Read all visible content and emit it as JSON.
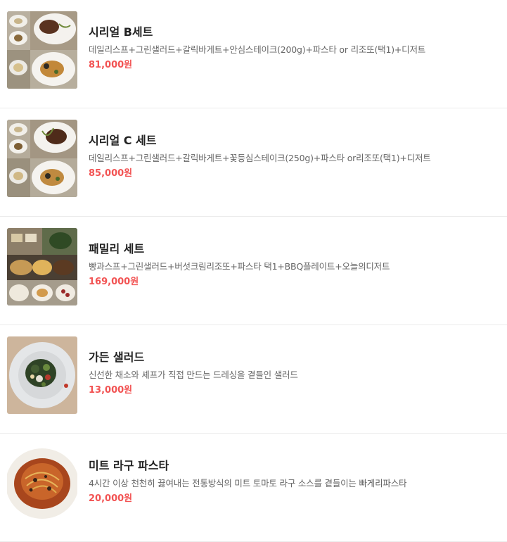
{
  "accent_price_color": "#f25353",
  "menu": [
    {
      "name": "시리얼 B세트",
      "description": "데일리스프+그린샐러드+갈릭바게트+안심스테이크(200g)+파스타 or 리조또(택1)+디저트",
      "price": "81,000원",
      "image": "set-course-photo-icon"
    },
    {
      "name": "시리얼 C 세트",
      "description": "데일리스프+그린샐러드+갈릭바게트+꽃등심스테이크(250g)+파스타 or리조또(택1)+디저트",
      "price": "85,000원",
      "image": "set-course-photo-icon"
    },
    {
      "name": "패밀리 세트",
      "description": "빵과스프+그린샐러드+버섯크림리조또+파스타 택1+BBQ플레이트+오늘의디저트",
      "price": "169,000원",
      "image": "family-set-photo-icon"
    },
    {
      "name": "가든 샐러드",
      "description": "신선한 채소와 셰프가 직접 만드는 드레싱을 곁들인 샐러드",
      "price": "13,000원",
      "image": "salad-photo-icon"
    },
    {
      "name": "미트 라구 파스타",
      "description": "4시간 이상 천천히 끓여내는 전통방식의 미트 토마토 라구 소스를 곁들이는 빠게리파스타",
      "price": "20,000원",
      "image": "pasta-photo-icon"
    }
  ]
}
